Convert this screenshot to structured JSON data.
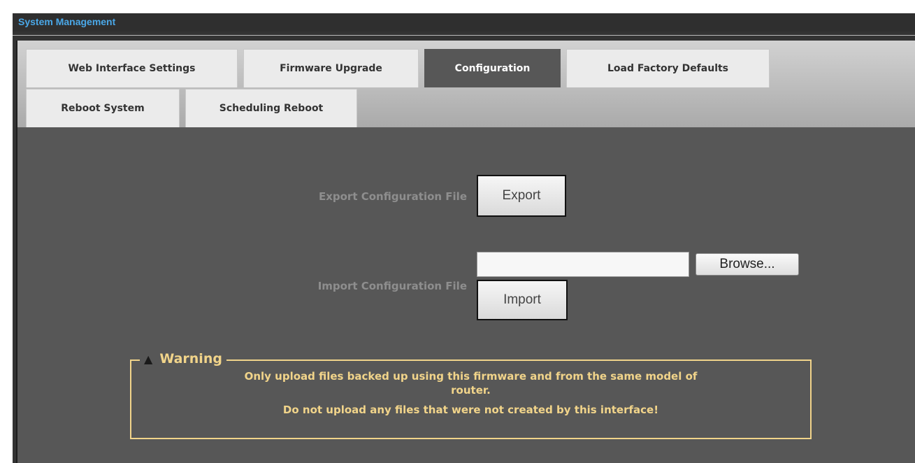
{
  "window": {
    "title": "System Management"
  },
  "tabs": [
    {
      "label": "Web Interface Settings",
      "active": false
    },
    {
      "label": "Firmware Upgrade",
      "active": false
    },
    {
      "label": "Configuration",
      "active": true
    },
    {
      "label": "Load Factory Defaults",
      "active": false
    },
    {
      "label": "Reboot System",
      "active": false
    },
    {
      "label": "Scheduling Reboot",
      "active": false
    }
  ],
  "export": {
    "label": "Export Configuration File",
    "button": "Export"
  },
  "import": {
    "label": "Import Configuration File",
    "file_value": "",
    "browse_button": "Browse...",
    "button": "Import"
  },
  "warning": {
    "icon": "warning-triangle-icon",
    "title": "Warning",
    "line1": "Only upload files backed up using this firmware and from the same model of",
    "line2": "router.",
    "line3": "Do not upload any files that were not created by this interface!"
  },
  "colors": {
    "title": "#4aa8e8",
    "warning": "#f1d48a",
    "panel": "#575757"
  }
}
